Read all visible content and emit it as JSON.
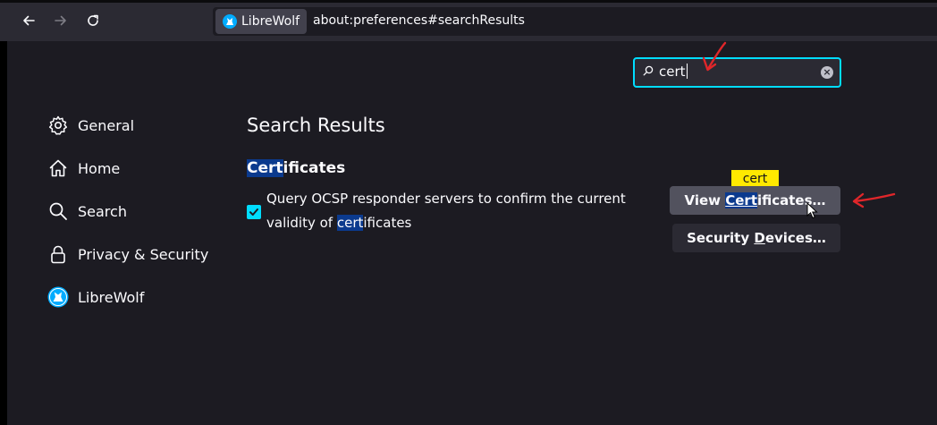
{
  "toolbar": {
    "back_label": "Back",
    "forward_label": "Forward",
    "reload_label": "Reload",
    "identity_label": "LibreWolf",
    "url": "about:preferences#searchResults"
  },
  "search": {
    "value": "cert",
    "clear_label": "×"
  },
  "sidebar": {
    "items": [
      {
        "label": "General",
        "icon": "gear-icon"
      },
      {
        "label": "Home",
        "icon": "home-icon"
      },
      {
        "label": "Search",
        "icon": "search-icon"
      },
      {
        "label": "Privacy & Security",
        "icon": "lock-icon"
      },
      {
        "label": "LibreWolf",
        "icon": "librewolf-icon"
      }
    ]
  },
  "main": {
    "title": "Search Results",
    "section": {
      "heading_hl": "Cert",
      "heading_rest": "ificates",
      "option": {
        "checked": true,
        "line1": "Query OCSP responder servers to confirm the current",
        "line2_pre": "validity of ",
        "line2_hl": "cert",
        "line2_post": "ificates"
      },
      "buttons": {
        "view_pre": "View ",
        "view_hl": "Cert",
        "view_post": "ificates…",
        "view_access_key": "C",
        "security_pre": "Security ",
        "security_key": "D",
        "security_post": "evices…"
      },
      "tooltip": "cert"
    }
  },
  "colors": {
    "accent": "#00ddff",
    "highlight": "#0b3a8e",
    "tooltip_bg": "#ffe900",
    "annotation": "#e0262a"
  }
}
